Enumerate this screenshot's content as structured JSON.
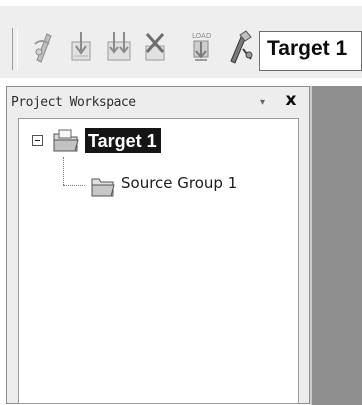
{
  "toolbar": {
    "target_value": "Target 1",
    "buttons": [
      {
        "icon": "translate-icon"
      },
      {
        "icon": "build-icon"
      },
      {
        "icon": "rebuild-all-icon"
      },
      {
        "icon": "stop-build-icon"
      },
      {
        "icon": "download-icon"
      },
      {
        "icon": "target-options-icon"
      }
    ]
  },
  "workspace": {
    "title": "Project Workspace",
    "menu_icon": "▾",
    "close_label": "x",
    "tree": {
      "root_label": "Target 1",
      "child_label": "Source Group 1"
    }
  }
}
